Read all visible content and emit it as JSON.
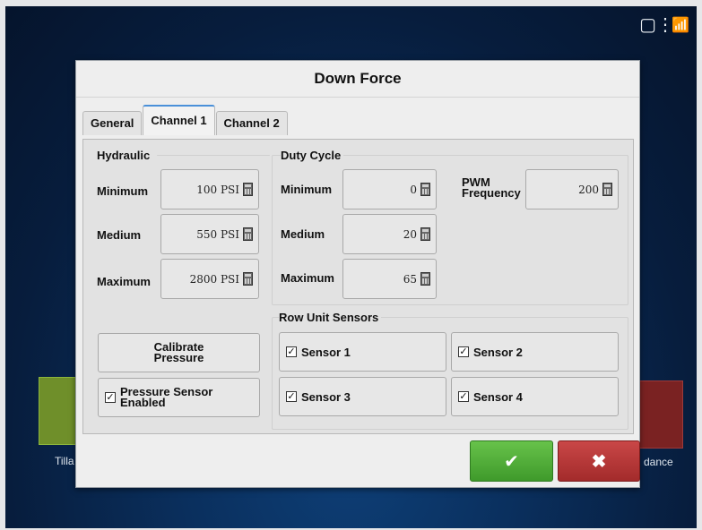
{
  "status": {
    "device_icon": "display-icon",
    "gps_icon": "gps-signal-icon"
  },
  "background": {
    "left_tile_label": "Tilla",
    "right_tile_label": "dance"
  },
  "dialog": {
    "title": "Down Force",
    "tabs": [
      {
        "label": "General"
      },
      {
        "label": "Channel 1"
      },
      {
        "label": "Channel 2"
      }
    ],
    "active_tab": "Channel 1",
    "hydraulic": {
      "title": "Hydraulic",
      "minimum_label": "Minimum",
      "minimum_value": "100 PSI",
      "medium_label": "Medium",
      "medium_value": "550 PSI",
      "maximum_label": "Maximum",
      "maximum_value": "2800 PSI"
    },
    "duty_cycle": {
      "title": "Duty Cycle",
      "minimum_label": "Minimum",
      "minimum_value": "0",
      "medium_label": "Medium",
      "medium_value": "20",
      "maximum_label": "Maximum",
      "maximum_value": "65",
      "pwm_label_line1": "PWM",
      "pwm_label_line2": "Frequency",
      "pwm_value": "200"
    },
    "calibrate_line1": "Calibrate",
    "calibrate_line2": "Pressure",
    "pressure_sensor_line1": "Pressure Sensor",
    "pressure_sensor_line2": "Enabled",
    "pressure_sensor_checked": "✓",
    "row_unit": {
      "title": "Row Unit Sensors",
      "sensors": [
        {
          "label": "Sensor 1",
          "check": "✓"
        },
        {
          "label": "Sensor 2",
          "check": "✓"
        },
        {
          "label": "Sensor 3",
          "check": "✓"
        },
        {
          "label": "Sensor 4",
          "check": "✓"
        }
      ]
    },
    "ok_icon": "✔",
    "cancel_icon": "✖"
  },
  "colors": {
    "accept": "#4aad35",
    "cancel": "#b33434",
    "tab_accent": "#4a90d9"
  }
}
